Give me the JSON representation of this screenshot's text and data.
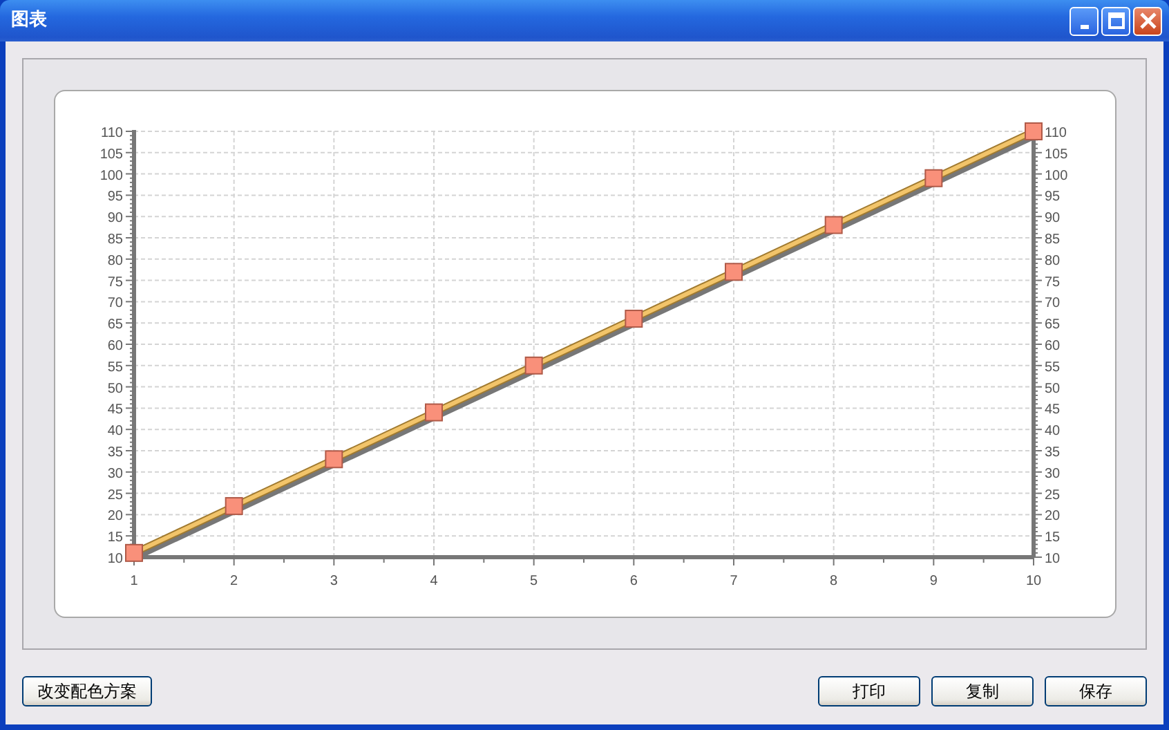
{
  "window": {
    "title": "图表"
  },
  "chart": {
    "chart_data": {
      "type": "line",
      "x": [
        1,
        2,
        3,
        4,
        5,
        6,
        7,
        8,
        9,
        10
      ],
      "grid": true,
      "series": [
        {
          "color": "#f2c46a",
          "marker": "square",
          "values": [
            11,
            22,
            33,
            44,
            55,
            66,
            77,
            88,
            99,
            110
          ]
        }
      ],
      "xlim": [
        1,
        10
      ],
      "ylim": [
        10,
        110
      ],
      "xticks": [
        1,
        2,
        3,
        4,
        5,
        6,
        7,
        8,
        9,
        10
      ],
      "yticks": [
        10,
        15,
        20,
        25,
        30,
        35,
        40,
        45,
        50,
        55,
        60,
        65,
        70,
        75,
        80,
        85,
        90,
        95,
        100,
        105,
        110
      ],
      "y2lim": [
        10,
        110
      ],
      "y2ticks": [
        10,
        15,
        20,
        25,
        30,
        35,
        40,
        45,
        50,
        55,
        60,
        65,
        70,
        75,
        80,
        85,
        90,
        95,
        100,
        105,
        110
      ]
    }
  },
  "buttons_left": [
    "改变配色方案"
  ],
  "buttons_right": [
    "打印",
    "复制",
    "保存"
  ]
}
